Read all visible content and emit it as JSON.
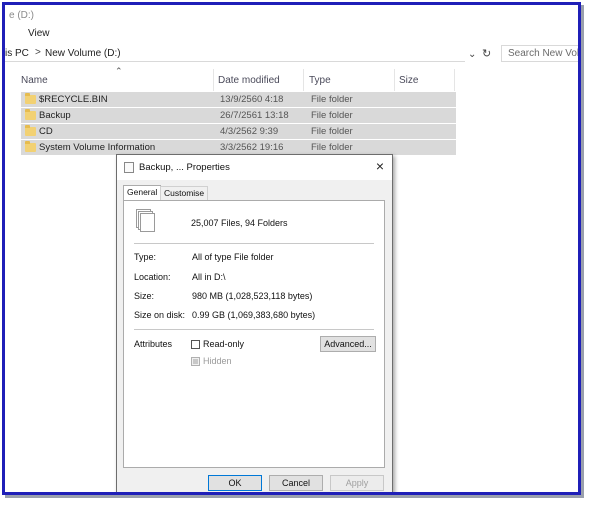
{
  "window": {
    "title": "e (D:)"
  },
  "menu": {
    "view": "View"
  },
  "address": {
    "crumbs": [
      "is PC",
      "New Volume (D:)"
    ],
    "sep": ">"
  },
  "search": {
    "placeholder": "Search New Volume"
  },
  "columns": {
    "name": "Name",
    "date": "Date modified",
    "type": "Type",
    "size": "Size"
  },
  "rows": [
    {
      "name": "$RECYCLE.BIN",
      "date": "13/9/2560 4:18",
      "type": "File folder"
    },
    {
      "name": "Backup",
      "date": "26/7/2561 13:18",
      "type": "File folder"
    },
    {
      "name": "CD",
      "date": "4/3/2562 9:39",
      "type": "File folder"
    },
    {
      "name": "System Volume Information",
      "date": "3/3/2562 19:16",
      "type": "File folder"
    }
  ],
  "dialog": {
    "title": "Backup, ... Properties",
    "close": "×",
    "tabs": {
      "general": "General",
      "customise": "Customise"
    },
    "summary": "25,007 Files, 94 Folders",
    "props": {
      "type_label": "Type:",
      "type_value": "All of type File folder",
      "location_label": "Location:",
      "location_value": "All in D:\\",
      "size_label": "Size:",
      "size_value": "980 MB (1,028,523,118 bytes)",
      "disk_label": "Size on disk:",
      "disk_value": "0.99 GB (1,069,383,680 bytes)"
    },
    "attributes_label": "Attributes",
    "readonly": "Read-only",
    "hidden": "Hidden",
    "advanced": "Advanced...",
    "ok": "OK",
    "cancel": "Cancel",
    "apply": "Apply"
  },
  "colors": {
    "frame": "#1f1fb8",
    "selection": "#d9d9d9",
    "folder": "#f2d173"
  }
}
